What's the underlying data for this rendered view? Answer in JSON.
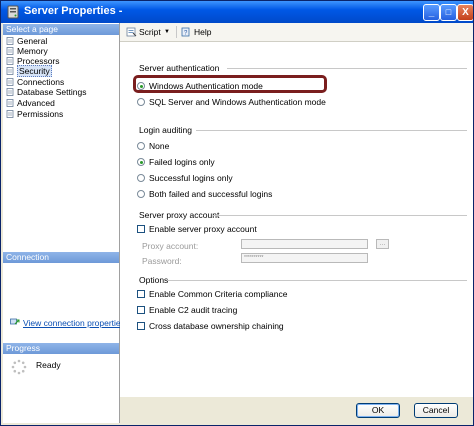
{
  "window": {
    "title": "Server Properties -",
    "minimize": "_",
    "maximize": "□",
    "close": "X"
  },
  "sidebar": {
    "select_page_header": "Select a page",
    "items": [
      {
        "label": "General"
      },
      {
        "label": "Memory"
      },
      {
        "label": "Processors"
      },
      {
        "label": "Security",
        "selected": true
      },
      {
        "label": "Connections"
      },
      {
        "label": "Database Settings"
      },
      {
        "label": "Advanced"
      },
      {
        "label": "Permissions"
      }
    ],
    "connection_header": "Connection",
    "connection_link": "View connection properties",
    "progress_header": "Progress",
    "progress_status": "Ready"
  },
  "toolbar": {
    "script_label": "Script",
    "help_label": "Help"
  },
  "server_authentication": {
    "label": "Server authentication",
    "options": [
      {
        "label": "Windows Authentication mode",
        "selected": true
      },
      {
        "label": "SQL Server and Windows Authentication mode",
        "selected": false
      }
    ]
  },
  "login_auditing": {
    "label": "Login auditing",
    "options": [
      {
        "label": "None",
        "selected": false
      },
      {
        "label": "Failed logins only",
        "selected": true
      },
      {
        "label": "Successful logins only",
        "selected": false
      },
      {
        "label": "Both failed and successful logins",
        "selected": false
      }
    ]
  },
  "server_proxy": {
    "label": "Server proxy account",
    "enable_label": "Enable server proxy account",
    "proxy_account_label": "Proxy account:",
    "proxy_account_value": "",
    "password_label": "Password:",
    "password_value": "**********",
    "browse_label": "..."
  },
  "options": {
    "label": "Options",
    "items": [
      {
        "label": "Enable Common Criteria compliance",
        "checked": false
      },
      {
        "label": "Enable C2 audit tracing",
        "checked": false
      },
      {
        "label": "Cross database ownership chaining",
        "checked": false
      }
    ]
  },
  "buttons": {
    "ok": "OK",
    "cancel": "Cancel"
  },
  "colors": {
    "title_bar": "#0058e6",
    "highlight_box": "#7a1e1e",
    "selected_radio": "#2a9a2a",
    "link": "#0b4fb3"
  }
}
